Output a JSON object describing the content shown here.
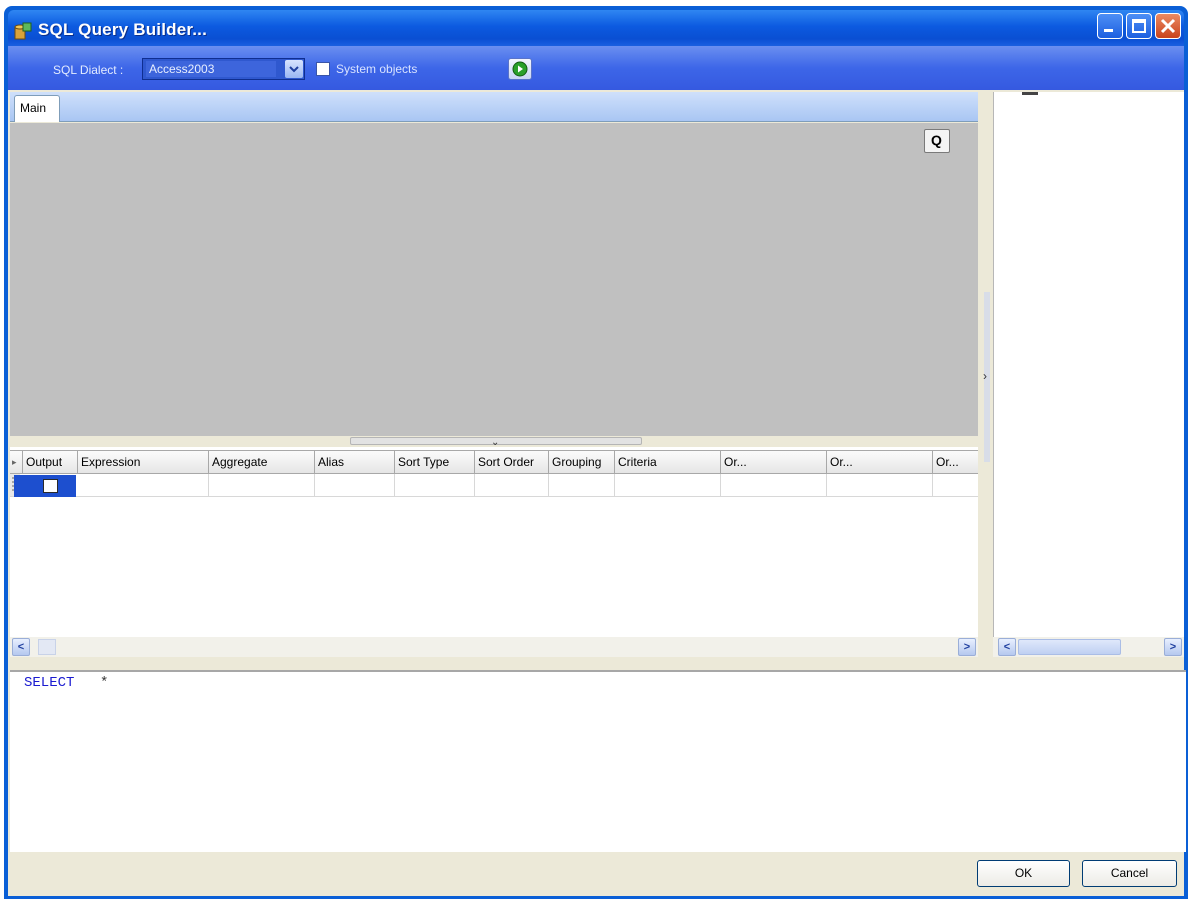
{
  "window": {
    "title": "SQL Query Builder..."
  },
  "toolbar": {
    "dialect_label": "SQL Dialect :",
    "dialect_value": "Access2003",
    "system_objects_label": "System objects",
    "system_objects_checked": false,
    "run_icon": "play-icon"
  },
  "design": {
    "tabs": [
      {
        "label": "Main",
        "active": true
      }
    ],
    "zoom_label": "Q",
    "canvas_color": "#c0c0c0"
  },
  "grid": {
    "columns": [
      "Output",
      "Expression",
      "Aggregate",
      "Alias",
      "Sort Type",
      "Sort Order",
      "Grouping",
      "Criteria",
      "Or...",
      "Or...",
      "Or..."
    ],
    "rows": [
      {
        "output_checked": false,
        "expression": "",
        "aggregate": "",
        "alias": "",
        "sort_type": "",
        "sort_order": "",
        "grouping": "",
        "criteria": ""
      }
    ],
    "selection_color": "#1d4fcf"
  },
  "sql_editor": {
    "keyword": "SELECT",
    "rest": "*"
  },
  "buttons": {
    "ok": "OK",
    "cancel": "Cancel"
  },
  "colors": {
    "titlebar": "#0c5ae0",
    "toolbar": "#3d66e8",
    "client": "#ece9d8",
    "sql_keyword": "#1a1ad0"
  }
}
